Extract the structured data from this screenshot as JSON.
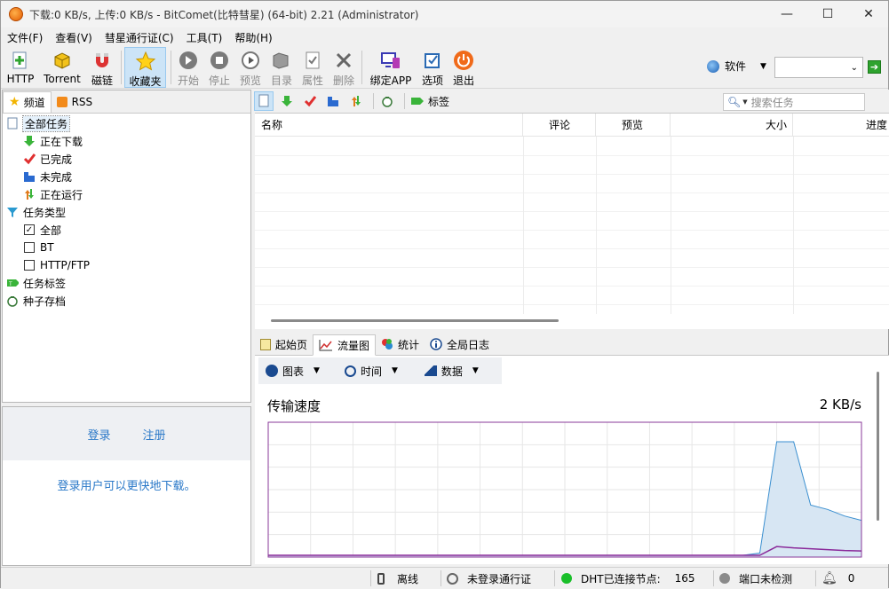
{
  "window": {
    "title": "下载:0 KB/s, 上传:0 KB/s - BitComet(比特彗星) (64-bit) 2.21 (Administrator)",
    "minimize": "—",
    "maximize": "☐",
    "close": "✕"
  },
  "menu": [
    "文件(F)",
    "查看(V)",
    "彗星通行证(C)",
    "工具(T)",
    "帮助(H)"
  ],
  "toolbar": {
    "http": "HTTP",
    "torrent": "Torrent",
    "magnet": "磁链",
    "favorites": "收藏夹",
    "start": "开始",
    "stop": "停止",
    "preview": "预览",
    "dir": "目录",
    "props": "属性",
    "delete": "删除",
    "bindapp": "绑定APP",
    "options": "选项",
    "exit": "退出",
    "software": "软件"
  },
  "left": {
    "tabs": {
      "channel": "频道",
      "rss": "RSS"
    },
    "tree": {
      "all": "全部任务",
      "downloading": "正在下载",
      "completed": "已完成",
      "incomplete": "未完成",
      "running": "正在运行",
      "types": "任务类型",
      "type_all": "全部",
      "type_bt": "BT",
      "type_http": "HTTP/FTP",
      "tags": "任务标签",
      "archive": "种子存档"
    },
    "login": {
      "login": "登录",
      "register": "注册",
      "message": "登录用户可以更快地下载。"
    }
  },
  "tasks": {
    "tag_label": "标签",
    "search_placeholder": "搜索任务",
    "columns": {
      "name": "名称",
      "comment": "评论",
      "preview": "预览",
      "size": "大小",
      "progress": "进度"
    }
  },
  "bottom_tabs": {
    "start": "起始页",
    "traffic": "流量图",
    "stats": "统计",
    "log": "全局日志"
  },
  "graph": {
    "tool_chart": "图表",
    "tool_time": "时间",
    "tool_data": "数据",
    "title": "传输速度",
    "value": "2 KB/s",
    "colors": {
      "download": "#3a8fd0",
      "upload": "#8a2a9a",
      "fill": "#d7e6f3"
    }
  },
  "chart_data": {
    "type": "area",
    "title": "传输速度",
    "xlabel": "",
    "ylabel": "",
    "ylim": [
      0,
      2.6
    ],
    "x": [
      0,
      1,
      2,
      3,
      4,
      5,
      6,
      7,
      8,
      9,
      10,
      11,
      12,
      13,
      14,
      15,
      16,
      17,
      18,
      19,
      20,
      21,
      22,
      23,
      24,
      25,
      26,
      27,
      28,
      29,
      30,
      31,
      32,
      33,
      34,
      35
    ],
    "series": [
      {
        "values": [
          0,
          0,
          0,
          0,
          0,
          0,
          0,
          0,
          0,
          0,
          0,
          0,
          0,
          0,
          0,
          0,
          0,
          0,
          0,
          0,
          0,
          0,
          0,
          0,
          0,
          0,
          0,
          0,
          0,
          0.05,
          2.6,
          2.6,
          1.15,
          1.05,
          0.9,
          0.8
        ]
      },
      {
        "values": [
          0,
          0,
          0,
          0,
          0,
          0,
          0,
          0,
          0,
          0,
          0,
          0,
          0,
          0,
          0,
          0,
          0,
          0,
          0,
          0,
          0,
          0,
          0,
          0,
          0,
          0,
          0,
          0,
          0,
          0,
          0.2,
          0.17,
          0.15,
          0.13,
          0.11,
          0.1
        ]
      }
    ]
  },
  "status": {
    "offline": "离线",
    "passport": "未登录通行证",
    "dht": "DHT已连接节点:",
    "dht_nodes": "165",
    "port": "端口未检测",
    "alerts": "0"
  }
}
